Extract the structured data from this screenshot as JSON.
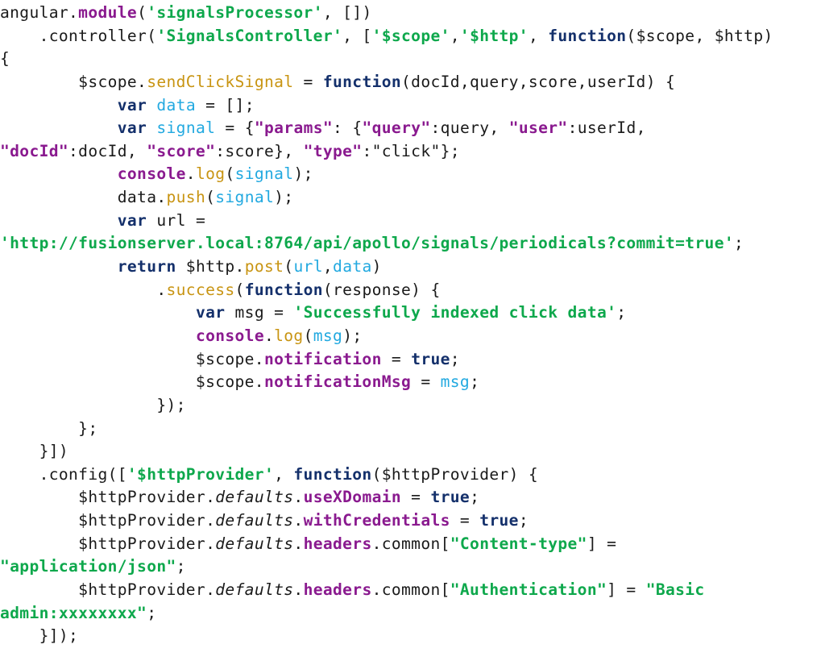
{
  "document": {
    "language": "javascript",
    "colors": {
      "keyword": "#14306b",
      "string": "#0ea84c",
      "property": "#8a1a8f",
      "method": "#c89412",
      "variable": "#22a9e0",
      "plain": "#1a1a1a",
      "background": "#ffffff"
    },
    "lines": [
      [
        [
          "pl",
          "angular."
        ],
        [
          "prop",
          "module"
        ],
        [
          "pl",
          "("
        ],
        [
          "str",
          "'signalsProcessor'"
        ],
        [
          "pl",
          ", [])"
        ]
      ],
      [
        [
          "pl",
          "    .controller("
        ],
        [
          "str",
          "'SignalsController'"
        ],
        [
          "pl",
          ", ["
        ],
        [
          "str",
          "'$scope'"
        ],
        [
          "pl",
          ","
        ],
        [
          "str",
          "'$http'"
        ],
        [
          "pl",
          ", "
        ],
        [
          "kw",
          "function"
        ],
        [
          "pl",
          "($scope, $http)"
        ]
      ],
      [
        [
          "pl",
          "{"
        ]
      ],
      [
        [
          "pl",
          "        $scope."
        ],
        [
          "meth",
          "sendClickSignal"
        ],
        [
          "pl",
          " = "
        ],
        [
          "kw",
          "function"
        ],
        [
          "pl",
          "(docId,query,score,userId) {"
        ]
      ],
      [
        [
          "pl",
          "            "
        ],
        [
          "kw",
          "var"
        ],
        [
          "pl",
          " "
        ],
        [
          "var",
          "data"
        ],
        [
          "pl",
          " = [];"
        ]
      ],
      [
        [
          "pl",
          "            "
        ],
        [
          "kw",
          "var"
        ],
        [
          "pl",
          " "
        ],
        [
          "var",
          "signal"
        ],
        [
          "pl",
          " = {"
        ],
        [
          "prop",
          "\"params\""
        ],
        [
          "pl",
          ": {"
        ],
        [
          "prop",
          "\"query\""
        ],
        [
          "pl",
          ":query, "
        ],
        [
          "prop",
          "\"user\""
        ],
        [
          "pl",
          ":userId,"
        ]
      ],
      [
        [
          "prop",
          "\"docId\""
        ],
        [
          "pl",
          ":docId, "
        ],
        [
          "prop",
          "\"score\""
        ],
        [
          "pl",
          ":score}, "
        ],
        [
          "prop",
          "\"type\""
        ],
        [
          "pl",
          ":\"click\"};"
        ]
      ],
      [
        [
          "pl",
          "            "
        ],
        [
          "prop",
          "console"
        ],
        [
          "pl",
          "."
        ],
        [
          "meth",
          "log"
        ],
        [
          "pl",
          "("
        ],
        [
          "var",
          "signal"
        ],
        [
          "pl",
          ");"
        ]
      ],
      [
        [
          "pl",
          "            data."
        ],
        [
          "meth",
          "push"
        ],
        [
          "pl",
          "("
        ],
        [
          "var",
          "signal"
        ],
        [
          "pl",
          ");"
        ]
      ],
      [
        [
          "pl",
          "            "
        ],
        [
          "kw",
          "var"
        ],
        [
          "pl",
          " url ="
        ]
      ],
      [
        [
          "str",
          "'http://fusionserver.local:8764/api/apollo/signals/periodicals?commit=true'"
        ],
        [
          "pl",
          ";"
        ]
      ],
      [
        [
          "pl",
          "            "
        ],
        [
          "kw",
          "return"
        ],
        [
          "pl",
          " $http."
        ],
        [
          "meth",
          "post"
        ],
        [
          "pl",
          "("
        ],
        [
          "var",
          "url"
        ],
        [
          "pl",
          ","
        ],
        [
          "var",
          "data"
        ],
        [
          "pl",
          ")"
        ]
      ],
      [
        [
          "pl",
          "                ."
        ],
        [
          "meth",
          "success"
        ],
        [
          "pl",
          "("
        ],
        [
          "kw",
          "function"
        ],
        [
          "pl",
          "(response) {"
        ]
      ],
      [
        [
          "pl",
          "                    "
        ],
        [
          "kw",
          "var"
        ],
        [
          "pl",
          " msg = "
        ],
        [
          "str",
          "'Successfully indexed click data'"
        ],
        [
          "pl",
          ";"
        ]
      ],
      [
        [
          "pl",
          "                    "
        ],
        [
          "prop",
          "console"
        ],
        [
          "pl",
          "."
        ],
        [
          "meth",
          "log"
        ],
        [
          "pl",
          "("
        ],
        [
          "var",
          "msg"
        ],
        [
          "pl",
          ");"
        ]
      ],
      [
        [
          "pl",
          "                    $scope."
        ],
        [
          "prop",
          "notification"
        ],
        [
          "pl",
          " = "
        ],
        [
          "kw",
          "true"
        ],
        [
          "pl",
          ";"
        ]
      ],
      [
        [
          "pl",
          "                    $scope."
        ],
        [
          "prop",
          "notificationMsg"
        ],
        [
          "pl",
          " = "
        ],
        [
          "var",
          "msg"
        ],
        [
          "pl",
          ";"
        ]
      ],
      [
        [
          "pl",
          "                });"
        ]
      ],
      [
        [
          "pl",
          "        };"
        ]
      ],
      [
        [
          "pl",
          "    }])"
        ]
      ],
      [
        [
          "pl",
          "    .config(["
        ],
        [
          "str",
          "'$httpProvider'"
        ],
        [
          "pl",
          ", "
        ],
        [
          "kw",
          "function"
        ],
        [
          "pl",
          "($httpProvider) {"
        ]
      ],
      [
        [
          "pl",
          "        $httpProvider."
        ],
        [
          "it",
          "defaults"
        ],
        [
          "pl",
          "."
        ],
        [
          "prop",
          "useXDomain"
        ],
        [
          "pl",
          " = "
        ],
        [
          "kw",
          "true"
        ],
        [
          "pl",
          ";"
        ]
      ],
      [
        [
          "pl",
          "        $httpProvider."
        ],
        [
          "it",
          "defaults"
        ],
        [
          "pl",
          "."
        ],
        [
          "prop",
          "withCredentials"
        ],
        [
          "pl",
          " = "
        ],
        [
          "kw",
          "true"
        ],
        [
          "pl",
          ";"
        ]
      ],
      [
        [
          "pl",
          "        $httpProvider."
        ],
        [
          "it",
          "defaults"
        ],
        [
          "pl",
          "."
        ],
        [
          "prop",
          "headers"
        ],
        [
          "pl",
          ".common["
        ],
        [
          "str",
          "\"Content-type\""
        ],
        [
          "pl",
          "] ="
        ]
      ],
      [
        [
          "str",
          "\"application/json\""
        ],
        [
          "pl",
          ";"
        ]
      ],
      [
        [
          "pl",
          "        $httpProvider."
        ],
        [
          "it",
          "defaults"
        ],
        [
          "pl",
          "."
        ],
        [
          "prop",
          "headers"
        ],
        [
          "pl",
          ".common["
        ],
        [
          "str",
          "\"Authentication\""
        ],
        [
          "pl",
          "] = "
        ],
        [
          "str",
          "\"Basic"
        ]
      ],
      [
        [
          "str",
          "admin:xxxxxxxx\""
        ],
        [
          "pl",
          ";"
        ]
      ],
      [
        [
          "pl",
          "    }]);"
        ]
      ]
    ]
  }
}
